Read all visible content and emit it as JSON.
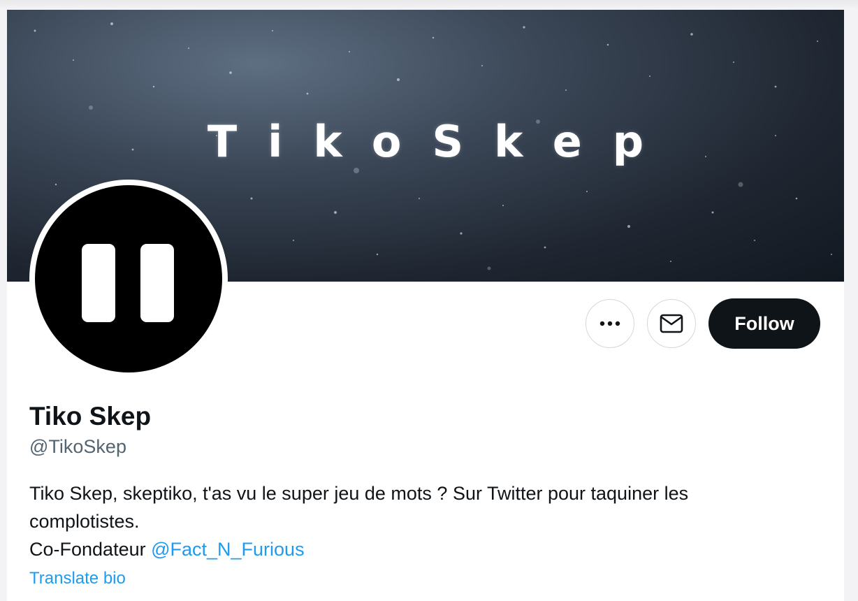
{
  "banner": {
    "title": "TikoSkep"
  },
  "profile": {
    "display_name": "Tiko Skep",
    "handle": "@TikoSkep",
    "bio_line1": "Tiko Skep, skeptiko, t'as vu le super jeu de mots ? Sur Twitter pour taquiner les",
    "bio_line2": "complotistes.",
    "bio_line3_prefix": "Co-Fondateur ",
    "bio_mention": "@Fact_N_Furious",
    "translate_label": "Translate bio"
  },
  "actions": {
    "more_icon": "more-horizontal-icon",
    "dm_icon": "envelope-icon",
    "follow_label": "Follow"
  },
  "colors": {
    "text_primary": "#0f1419",
    "text_secondary": "#536471",
    "link": "#1d9bf0",
    "follow_bg": "#0f1419"
  }
}
